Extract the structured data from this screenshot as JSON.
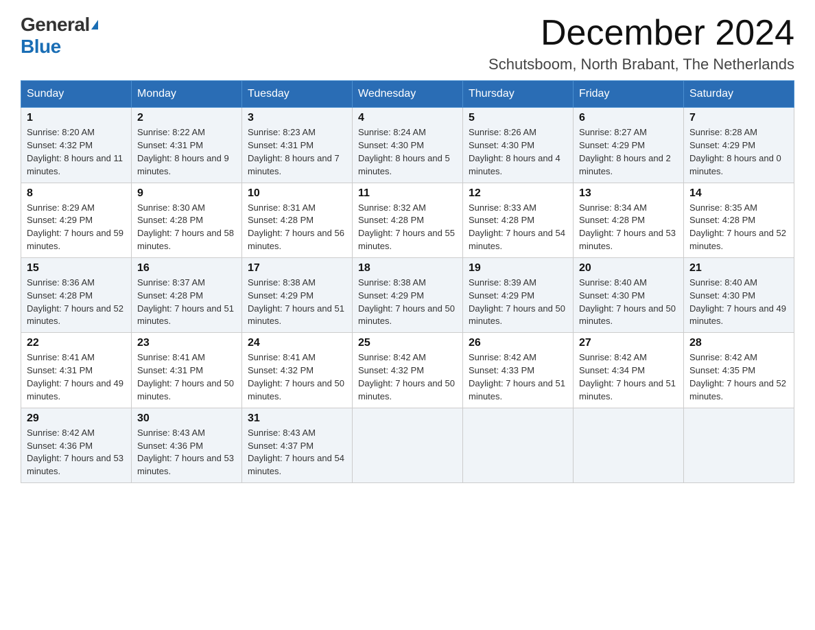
{
  "logo": {
    "general": "General",
    "blue": "Blue"
  },
  "title": "December 2024",
  "location": "Schutsboom, North Brabant, The Netherlands",
  "days_of_week": [
    "Sunday",
    "Monday",
    "Tuesday",
    "Wednesday",
    "Thursday",
    "Friday",
    "Saturday"
  ],
  "weeks": [
    [
      {
        "day": "1",
        "sunrise": "8:20 AM",
        "sunset": "4:32 PM",
        "daylight": "8 hours and 11 minutes."
      },
      {
        "day": "2",
        "sunrise": "8:22 AM",
        "sunset": "4:31 PM",
        "daylight": "8 hours and 9 minutes."
      },
      {
        "day": "3",
        "sunrise": "8:23 AM",
        "sunset": "4:31 PM",
        "daylight": "8 hours and 7 minutes."
      },
      {
        "day": "4",
        "sunrise": "8:24 AM",
        "sunset": "4:30 PM",
        "daylight": "8 hours and 5 minutes."
      },
      {
        "day": "5",
        "sunrise": "8:26 AM",
        "sunset": "4:30 PM",
        "daylight": "8 hours and 4 minutes."
      },
      {
        "day": "6",
        "sunrise": "8:27 AM",
        "sunset": "4:29 PM",
        "daylight": "8 hours and 2 minutes."
      },
      {
        "day": "7",
        "sunrise": "8:28 AM",
        "sunset": "4:29 PM",
        "daylight": "8 hours and 0 minutes."
      }
    ],
    [
      {
        "day": "8",
        "sunrise": "8:29 AM",
        "sunset": "4:29 PM",
        "daylight": "7 hours and 59 minutes."
      },
      {
        "day": "9",
        "sunrise": "8:30 AM",
        "sunset": "4:28 PM",
        "daylight": "7 hours and 58 minutes."
      },
      {
        "day": "10",
        "sunrise": "8:31 AM",
        "sunset": "4:28 PM",
        "daylight": "7 hours and 56 minutes."
      },
      {
        "day": "11",
        "sunrise": "8:32 AM",
        "sunset": "4:28 PM",
        "daylight": "7 hours and 55 minutes."
      },
      {
        "day": "12",
        "sunrise": "8:33 AM",
        "sunset": "4:28 PM",
        "daylight": "7 hours and 54 minutes."
      },
      {
        "day": "13",
        "sunrise": "8:34 AM",
        "sunset": "4:28 PM",
        "daylight": "7 hours and 53 minutes."
      },
      {
        "day": "14",
        "sunrise": "8:35 AM",
        "sunset": "4:28 PM",
        "daylight": "7 hours and 52 minutes."
      }
    ],
    [
      {
        "day": "15",
        "sunrise": "8:36 AM",
        "sunset": "4:28 PM",
        "daylight": "7 hours and 52 minutes."
      },
      {
        "day": "16",
        "sunrise": "8:37 AM",
        "sunset": "4:28 PM",
        "daylight": "7 hours and 51 minutes."
      },
      {
        "day": "17",
        "sunrise": "8:38 AM",
        "sunset": "4:29 PM",
        "daylight": "7 hours and 51 minutes."
      },
      {
        "day": "18",
        "sunrise": "8:38 AM",
        "sunset": "4:29 PM",
        "daylight": "7 hours and 50 minutes."
      },
      {
        "day": "19",
        "sunrise": "8:39 AM",
        "sunset": "4:29 PM",
        "daylight": "7 hours and 50 minutes."
      },
      {
        "day": "20",
        "sunrise": "8:40 AM",
        "sunset": "4:30 PM",
        "daylight": "7 hours and 50 minutes."
      },
      {
        "day": "21",
        "sunrise": "8:40 AM",
        "sunset": "4:30 PM",
        "daylight": "7 hours and 49 minutes."
      }
    ],
    [
      {
        "day": "22",
        "sunrise": "8:41 AM",
        "sunset": "4:31 PM",
        "daylight": "7 hours and 49 minutes."
      },
      {
        "day": "23",
        "sunrise": "8:41 AM",
        "sunset": "4:31 PM",
        "daylight": "7 hours and 50 minutes."
      },
      {
        "day": "24",
        "sunrise": "8:41 AM",
        "sunset": "4:32 PM",
        "daylight": "7 hours and 50 minutes."
      },
      {
        "day": "25",
        "sunrise": "8:42 AM",
        "sunset": "4:32 PM",
        "daylight": "7 hours and 50 minutes."
      },
      {
        "day": "26",
        "sunrise": "8:42 AM",
        "sunset": "4:33 PM",
        "daylight": "7 hours and 51 minutes."
      },
      {
        "day": "27",
        "sunrise": "8:42 AM",
        "sunset": "4:34 PM",
        "daylight": "7 hours and 51 minutes."
      },
      {
        "day": "28",
        "sunrise": "8:42 AM",
        "sunset": "4:35 PM",
        "daylight": "7 hours and 52 minutes."
      }
    ],
    [
      {
        "day": "29",
        "sunrise": "8:42 AM",
        "sunset": "4:36 PM",
        "daylight": "7 hours and 53 minutes."
      },
      {
        "day": "30",
        "sunrise": "8:43 AM",
        "sunset": "4:36 PM",
        "daylight": "7 hours and 53 minutes."
      },
      {
        "day": "31",
        "sunrise": "8:43 AM",
        "sunset": "4:37 PM",
        "daylight": "7 hours and 54 minutes."
      },
      null,
      null,
      null,
      null
    ]
  ]
}
